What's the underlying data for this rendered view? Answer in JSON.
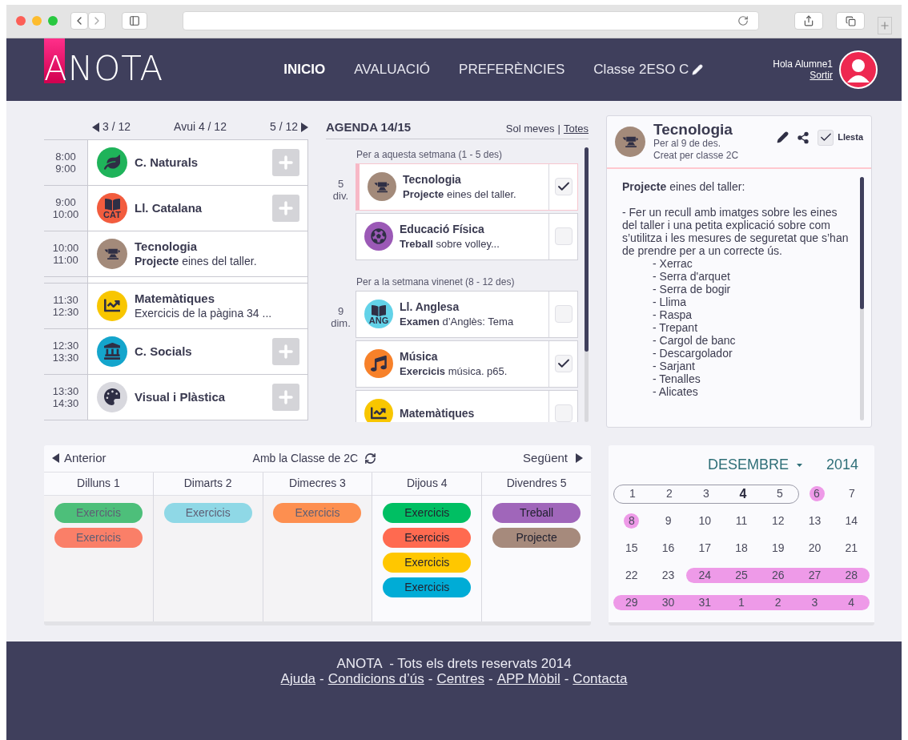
{
  "header": {
    "logo": "ANOTA",
    "nav": [
      {
        "label": "INICIO",
        "selected": true
      },
      {
        "label": "AVALUACIÓ",
        "selected": false
      },
      {
        "label": "PREFERÈNCIES",
        "selected": false
      }
    ],
    "class_label": "Classe 2ESO C",
    "greeting": "Hola Alumne1",
    "logout": "Sortir"
  },
  "schedule": {
    "prev": "3 / 12",
    "today": "Avui 4 / 12",
    "next": "5 / 12",
    "slots": [
      {
        "kind": "leaf",
        "start": "8:00",
        "end": "9:00",
        "subject": "C. Naturals",
        "color": "#1fb35a",
        "has_add": true
      },
      {
        "kind": "book",
        "start": "9:00",
        "end": "10:00",
        "subject": "Ll. Catalana",
        "icon_text": "CAT",
        "color": "#f25c3e",
        "has_add": true
      },
      {
        "kind": "anvil",
        "start": "10:00",
        "end": "11:00",
        "subject": "Tecnologia",
        "note": "**Projecte** eines del taller.",
        "color": "#a38a7a",
        "has_add": false
      },
      {
        "kind": "break"
      },
      {
        "kind": "chart",
        "start": "11:30",
        "end": "12:30",
        "subject": "Matemàtiques",
        "note": "Exercicis de la pàgina 34 ...",
        "color": "#f8c600",
        "has_add": false
      },
      {
        "kind": "bank",
        "start": "12:30",
        "end": "13:30",
        "subject": "C. Socials",
        "color": "#14a5cc",
        "has_add": true
      },
      {
        "kind": "palette",
        "start": "13:30",
        "end": "14:30",
        "subject": "Visual i Plàstica",
        "color": "#d8d8de",
        "has_add": true
      }
    ]
  },
  "agenda": {
    "title": "AGENDA 14/15",
    "filters": [
      {
        "label": "Sol meves",
        "selected": false
      },
      {
        "label": "Totes",
        "selected": true
      }
    ],
    "filter_separator": "|",
    "groups": [
      {
        "heading": "Per a aquesta setmana (1 - 5 des)",
        "day": "5",
        "weekday": "div.",
        "items": [
          {
            "kind": "anvil",
            "subject": "Tecnologia",
            "note": "**Projecte** eines del taller.",
            "color": "#a38a7a",
            "checked": true,
            "selected": true
          },
          {
            "kind": "ball",
            "subject": "Educació Física",
            "note": "**Treball** sobre volley...",
            "color": "#9b59b6",
            "checked": false,
            "selected": false
          }
        ]
      },
      {
        "heading": "Per a la setmana vinenet (8 - 12 des)",
        "day": "9",
        "weekday": "dim.",
        "items": [
          {
            "kind": "book",
            "subject": "Ll. Anglesa",
            "note": "**Examen** d’Anglès: Tema",
            "icon_text": "ANG",
            "color": "#62d2e8",
            "checked": false,
            "selected": false
          },
          {
            "kind": "music",
            "subject": "Música",
            "note": "**Exercicis** música. p65.",
            "color": "#f7812a",
            "checked": true,
            "selected": false
          },
          {
            "kind": "chart",
            "subject": "Matemàtiques",
            "color": "#f8c600",
            "checked": false,
            "selected": false
          }
        ]
      }
    ]
  },
  "detail": {
    "kind": "anvil",
    "title": "Tecnologia",
    "due": "Per al 9 de des.",
    "creator": "Creat per classe 2C",
    "done_label": "Llesta",
    "done": true,
    "color": "#a38a7a",
    "intro": "**Projecte** eines del taller:",
    "paragraph": "- Fer un recull amb imatges sobre les eines del taller i una petita explicació sobre com s’utilitza i les mesures de seguretat que s’han de prendre per a un correcte ús.",
    "list": [
      "- Xerrac",
      "- Serra d'arquet",
      "- Serra de bogir",
      "- Llima",
      "- Raspa",
      "- Trepant",
      "- Cargol de banc",
      "- Descargolador",
      "- Sarjant",
      "- Tenalles",
      "- Alicates"
    ]
  },
  "week": {
    "prev": "Anterior",
    "title": "Amb la Classe de 2C",
    "next": "Següent",
    "days": [
      {
        "name": "Dilluns",
        "num": "1",
        "past": true,
        "tasks": [
          {
            "label": "Exercicis",
            "color": "#4dbf7a"
          },
          {
            "label": "Exercicis",
            "color": "#fa7f68"
          }
        ]
      },
      {
        "name": "Dimarts",
        "num": "2",
        "past": true,
        "tasks": [
          {
            "label": "Exercicis",
            "color": "#8fd8e6"
          }
        ]
      },
      {
        "name": "Dimecres",
        "num": "3",
        "past": true,
        "tasks": [
          {
            "label": "Exercicis",
            "color": "#fd8f50"
          }
        ]
      },
      {
        "name": "Dijous",
        "num": "4",
        "past": false,
        "tasks": [
          {
            "label": "Exercicis",
            "color": "#00bf63"
          },
          {
            "label": "Exercicis",
            "color": "#ff6a50"
          },
          {
            "label": "Exercicis",
            "color": "#ffc700"
          },
          {
            "label": "Exercicis",
            "color": "#00acd6"
          }
        ]
      },
      {
        "name": "Divendres",
        "num": "5",
        "past": false,
        "tasks": [
          {
            "label": "Treball",
            "color": "#a066ba"
          },
          {
            "label": "Projecte",
            "color": "#a68a7c"
          }
        ]
      }
    ]
  },
  "calendar": {
    "month": "DESEMBRE",
    "year": "2014",
    "weeks": [
      {
        "current": true,
        "days": [
          {
            "label": "1",
            "today": false,
            "marked": false
          },
          {
            "label": "2",
            "today": false,
            "marked": false
          },
          {
            "label": "3",
            "today": false,
            "marked": false
          },
          {
            "label": "4",
            "today": true,
            "marked": false
          },
          {
            "label": "5",
            "today": false,
            "marked": false
          },
          {
            "label": "6",
            "today": false,
            "marked": true
          },
          {
            "label": "7",
            "today": false,
            "marked": false
          }
        ]
      },
      {
        "current": false,
        "days": [
          {
            "label": "8",
            "today": false,
            "marked": true
          },
          {
            "label": "9",
            "today": false,
            "marked": false
          },
          {
            "label": "10",
            "today": false,
            "marked": false
          },
          {
            "label": "11",
            "today": false,
            "marked": false
          },
          {
            "label": "12",
            "today": false,
            "marked": false
          },
          {
            "label": "13",
            "today": false,
            "marked": false
          },
          {
            "label": "14",
            "today": false,
            "marked": false
          }
        ]
      },
      {
        "current": false,
        "days": [
          {
            "label": "15",
            "today": false,
            "marked": false
          },
          {
            "label": "16",
            "today": false,
            "marked": false
          },
          {
            "label": "17",
            "today": false,
            "marked": false
          },
          {
            "label": "18",
            "today": false,
            "marked": false
          },
          {
            "label": "19",
            "today": false,
            "marked": false
          },
          {
            "label": "20",
            "today": false,
            "marked": false
          },
          {
            "label": "21",
            "today": false,
            "marked": false
          }
        ]
      },
      {
        "current": false,
        "days": [
          {
            "label": "22",
            "today": false,
            "marked": false
          },
          {
            "label": "23",
            "today": false,
            "marked": false
          },
          {
            "label": "24",
            "today": false,
            "marked": true
          },
          {
            "label": "25",
            "today": false,
            "marked": true
          },
          {
            "label": "26",
            "today": false,
            "marked": true
          },
          {
            "label": "27",
            "today": false,
            "marked": true
          },
          {
            "label": "28",
            "today": false,
            "marked": true
          }
        ]
      },
      {
        "current": false,
        "days": [
          {
            "label": "29",
            "today": false,
            "marked": true
          },
          {
            "label": "30",
            "today": false,
            "marked": true
          },
          {
            "label": "31",
            "today": false,
            "marked": true
          },
          {
            "label": "1",
            "today": false,
            "marked": true
          },
          {
            "label": "2",
            "today": false,
            "marked": true
          },
          {
            "label": "3",
            "today": false,
            "marked": true
          },
          {
            "label": "4",
            "today": false,
            "marked": true
          }
        ]
      }
    ]
  },
  "footer": {
    "text": "ANOTA  - Tots els drets reservats 2014",
    "separator": "-",
    "links": [
      "Ajuda",
      "Condicions d’ús",
      "Centres",
      "APP Mòbil",
      "Contacta"
    ]
  }
}
